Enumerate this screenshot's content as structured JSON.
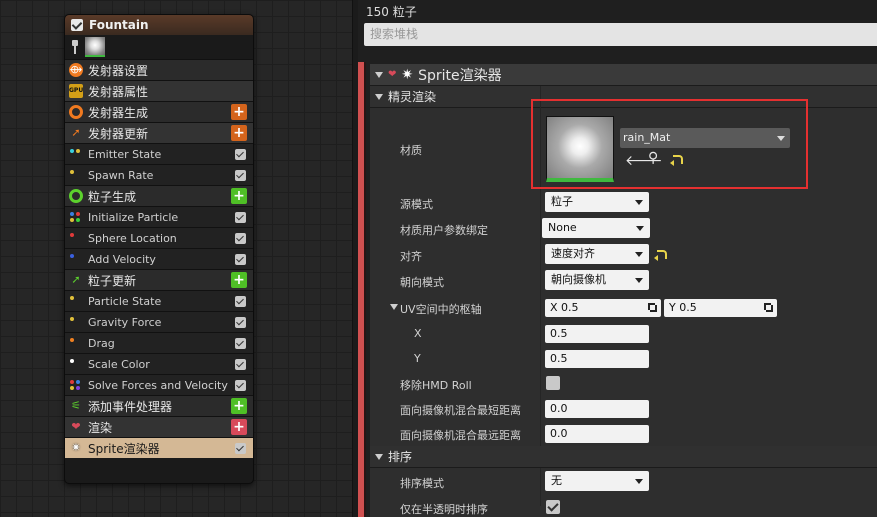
{
  "graph": {
    "node": {
      "title": "Fountain",
      "rows": [
        {
          "kind": "section",
          "label": "发射器设置",
          "icon": "emitter-settings-icon"
        },
        {
          "kind": "section",
          "label": "发射器属性",
          "icon": "gpu-icon",
          "icon_text": "GPU"
        },
        {
          "kind": "section",
          "label": "发射器生成",
          "icon": "emitter-spawn-icon",
          "add": true,
          "add_color": "#d4641c"
        },
        {
          "kind": "section",
          "label": "发射器更新",
          "icon": "emitter-update-icon",
          "add": true,
          "add_color": "#d4641c"
        },
        {
          "kind": "module",
          "label": "Emitter State"
        },
        {
          "kind": "module",
          "label": "Spawn Rate"
        },
        {
          "kind": "section",
          "label": "粒子生成",
          "icon": "particle-spawn-icon",
          "add": true,
          "add_color": "#4fbf26"
        },
        {
          "kind": "module",
          "label": "Initialize Particle"
        },
        {
          "kind": "module",
          "label": "Sphere Location"
        },
        {
          "kind": "module",
          "label": "Add Velocity"
        },
        {
          "kind": "section",
          "label": "粒子更新",
          "icon": "particle-update-icon",
          "add": true,
          "add_color": "#4fbf26"
        },
        {
          "kind": "module",
          "label": "Particle State"
        },
        {
          "kind": "module",
          "label": "Gravity Force"
        },
        {
          "kind": "module",
          "label": "Drag"
        },
        {
          "kind": "module",
          "label": "Scale Color"
        },
        {
          "kind": "module",
          "label": "Solve Forces and Velocity"
        },
        {
          "kind": "section",
          "label": "添加事件处理器",
          "icon": "event-handler-icon",
          "add": true,
          "add_color": "#4fbf26"
        },
        {
          "kind": "section",
          "label": "渲染",
          "icon": "render-icon",
          "add": true,
          "add_color": "#d84a5a"
        },
        {
          "kind": "selected",
          "label": "Sprite渲染器",
          "icon": "sprite-icon"
        }
      ]
    }
  },
  "details": {
    "count_label": "150 粒子",
    "search_placeholder": "搜索堆栈",
    "renderer_title": "Sprite渲染器",
    "cat_sprite": "精灵渲染",
    "material_label": "材质",
    "material_value": "rain_Mat",
    "source_mode_label": "源模式",
    "source_mode_value": "粒子",
    "mat_param_label": "材质用户参数绑定",
    "mat_param_value": "None",
    "alignment_label": "对齐",
    "alignment_value": "速度对齐",
    "facing_label": "朝向模式",
    "facing_value": "朝向摄像机",
    "pivot_label": "UV空间中的枢轴",
    "pivot_x_text": "X  0.5",
    "pivot_y_text": "Y  0.5",
    "x_label": "X",
    "x_value": "0.5",
    "y_label": "Y",
    "y_value": "0.5",
    "hmd_label": "移除HMD Roll",
    "min_dist_label": "面向摄像机混合最短距离",
    "min_dist_value": "0.0",
    "max_dist_label": "面向摄像机混合最远距离",
    "max_dist_value": "0.0",
    "cat_sort": "排序",
    "sort_mode_label": "排序模式",
    "sort_mode_value": "无",
    "sort_translucent_label": "仅在半透明时排序"
  }
}
